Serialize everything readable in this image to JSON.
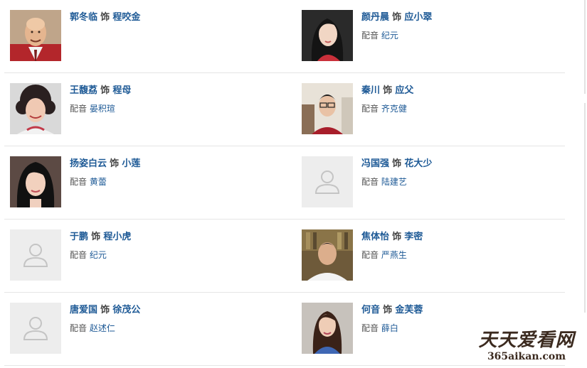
{
  "labels": {
    "plays": "饰",
    "dub": "配音"
  },
  "cast": [
    {
      "actor": "郭冬临",
      "role": "程咬金",
      "dub": "",
      "avatar": "photo-bald-man-red-suit"
    },
    {
      "actor": "颜丹晨",
      "role": "应小翠",
      "dub": "纪元",
      "avatar": "photo-woman-dark-hair"
    },
    {
      "actor": "王馥荔",
      "role": "程母",
      "dub": "晏积瑄",
      "avatar": "photo-older-woman-curly"
    },
    {
      "actor": "秦川",
      "role": "应父",
      "dub": "齐克健",
      "avatar": "photo-young-man-glasses"
    },
    {
      "actor": "扬姿白云",
      "role": "小莲",
      "dub": "黄蕾",
      "avatar": "photo-woman-black-hair"
    },
    {
      "actor": "冯国强",
      "role": "花大少",
      "dub": "陆建艺",
      "avatar": "placeholder-icon"
    },
    {
      "actor": "于鹏",
      "role": "程小虎",
      "dub": "纪元",
      "avatar": "placeholder-icon"
    },
    {
      "actor": "焦体怡",
      "role": "李密",
      "dub": "严燕生",
      "avatar": "photo-man-bookshelf"
    },
    {
      "actor": "唐爱国",
      "role": "徐茂公",
      "dub": "赵述仁",
      "avatar": "placeholder-icon"
    },
    {
      "actor": "何音",
      "role": "金芙蓉",
      "dub": "薛白",
      "avatar": "photo-woman-blue-dress"
    }
  ],
  "watermark": {
    "main": "天天爱看网",
    "sub": "365aikan.com"
  }
}
